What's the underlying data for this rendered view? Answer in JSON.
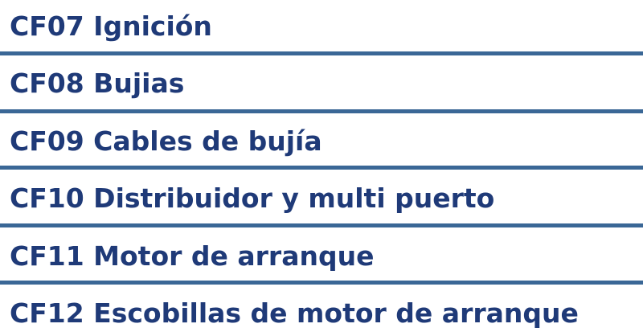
{
  "items": [
    {
      "label": "CF07 Ignición"
    },
    {
      "label": "CF08 Bujias"
    },
    {
      "label": "CF09 Cables de bujía"
    },
    {
      "label": "CF10 Distribuidor y multi puerto"
    },
    {
      "label": "CF11 Motor de arranque"
    },
    {
      "label": "CF12 Escobillas de motor de arranque"
    }
  ],
  "colors": {
    "text": "#1f3a78",
    "divider": "#3a6796",
    "background": "#ffffff"
  }
}
